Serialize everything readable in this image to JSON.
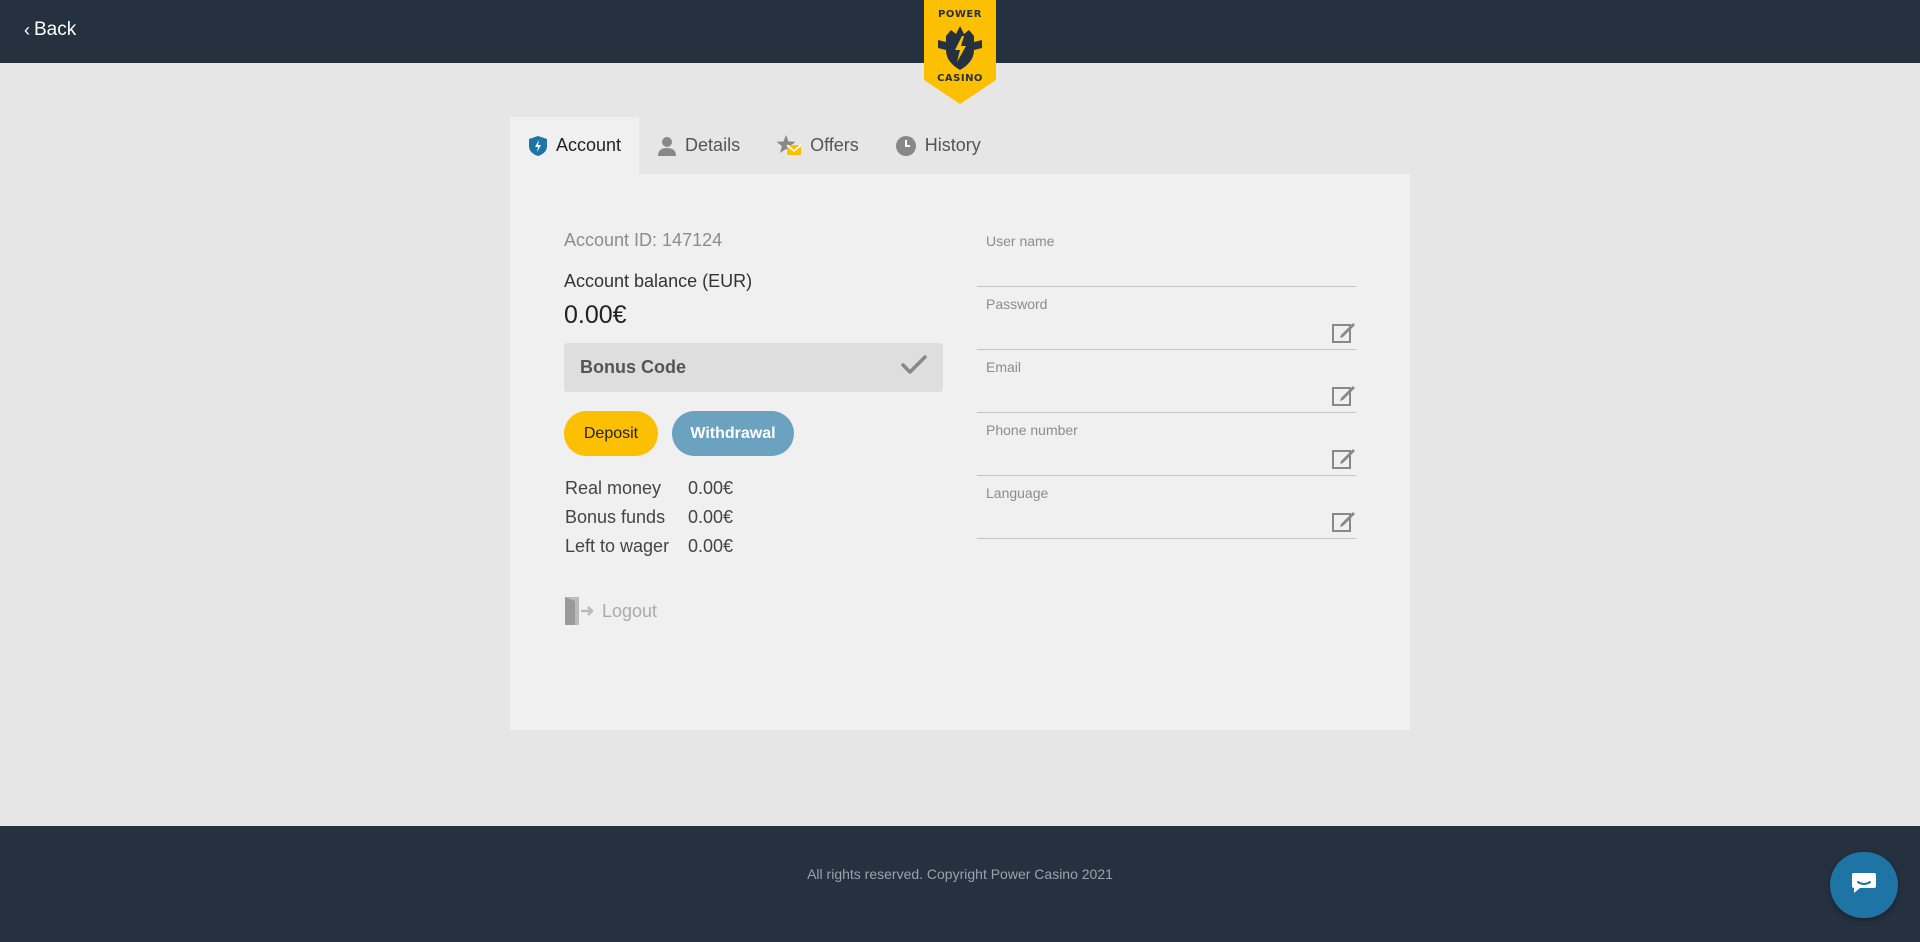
{
  "header": {
    "back_label": "Back",
    "logo": {
      "line1": "POWER",
      "line2": "CASINO",
      "icon": "lightning-shield-crest"
    }
  },
  "tabs": [
    {
      "label": "Account",
      "icon": "shield-lightning-icon",
      "active": true
    },
    {
      "label": "Details",
      "icon": "user-icon",
      "active": false
    },
    {
      "label": "Offers",
      "icon": "star-envelope-icon",
      "active": false
    },
    {
      "label": "History",
      "icon": "clock-icon",
      "active": false
    }
  ],
  "account": {
    "id_label": "Account ID: 147124",
    "balance_label": "Account balance (EUR)",
    "balance_value": "0.00€",
    "bonus_code_label": "Bonus Code",
    "deposit_label": "Deposit",
    "withdrawal_label": "Withdrawal",
    "funds": [
      {
        "label": "Real money",
        "value": "0.00€"
      },
      {
        "label": "Bonus funds",
        "value": "0.00€"
      },
      {
        "label": "Left to wager",
        "value": "0.00€"
      }
    ],
    "logout_label": "Logout"
  },
  "profile_fields": [
    {
      "label": "User name",
      "value": "",
      "editable": false
    },
    {
      "label": "Password",
      "value": "",
      "editable": true
    },
    {
      "label": "Email",
      "value": "",
      "editable": true
    },
    {
      "label": "Phone number",
      "value": "",
      "editable": true
    },
    {
      "label": "Language",
      "value": "",
      "editable": true
    }
  ],
  "footer": {
    "copyright": "All rights reserved. Copyright Power Casino 2021"
  },
  "colors": {
    "topbar": "#263140",
    "accent_yellow": "#fcc000",
    "withdraw_blue": "#6ba2c0",
    "chat_blue": "#1f74a6"
  }
}
